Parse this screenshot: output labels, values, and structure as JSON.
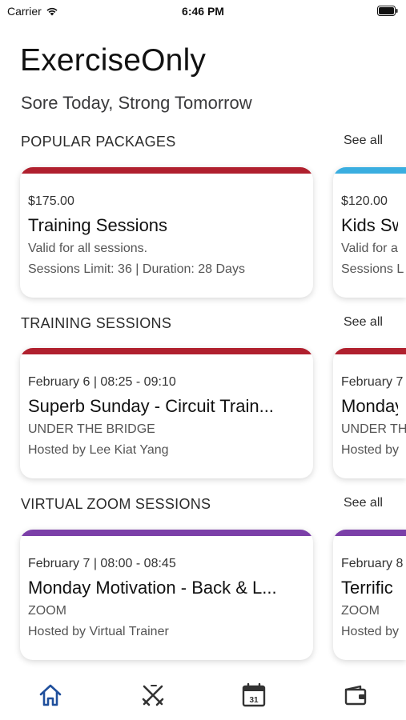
{
  "status_bar": {
    "carrier": "Carrier",
    "time": "6:46 PM",
    "wifi_icon": "wifi-icon",
    "battery_icon": "battery-icon"
  },
  "app": {
    "title": "ExerciseOnly",
    "subtitle": "Sore Today, Strong Tomorrow"
  },
  "sections": [
    {
      "header": "POPULAR PACKAGES",
      "see_all": "See all",
      "cards": [
        {
          "color": "#b0202e",
          "line1": "$175.00",
          "title": "Training Sessions",
          "line3": "Valid for all sessions.",
          "line4": "Sessions Limit: 36 | Duration: 28 Days"
        },
        {
          "color": "#3aaee0",
          "line1": "$120.00",
          "title": "Kids Sw",
          "line3": "Valid for a",
          "line4": "Sessions L"
        }
      ]
    },
    {
      "header": "TRAINING SESSIONS",
      "see_all": "See all",
      "cards": [
        {
          "color": "#b0202e",
          "line1": "February 6 | 08:25 - 09:10",
          "title": "Superb Sunday - Circuit Train...",
          "line3": "UNDER THE BRIDGE",
          "line4": "Hosted by Lee Kiat Yang"
        },
        {
          "color": "#b0202e",
          "line1": "February 7",
          "title": "Monday",
          "line3": "UNDER TH",
          "line4": "Hosted by"
        }
      ]
    },
    {
      "header": "VIRTUAL ZOOM SESSIONS",
      "see_all": "See all",
      "cards": [
        {
          "color": "#7b3fa8",
          "line1": "February 7 | 08:00 - 08:45",
          "title": "Monday Motivation - Back & L...",
          "line3": "ZOOM",
          "line4": "Hosted by Virtual Trainer"
        },
        {
          "color": "#7b3fa8",
          "line1": "February 8",
          "title": "Terrific",
          "line3": "ZOOM",
          "line4": "Hosted by"
        }
      ]
    }
  ],
  "tab_bar": {
    "active_color": "#1f4f9c",
    "inactive_color": "#333333",
    "tabs": [
      "home-icon",
      "cross-swords-icon",
      "calendar-icon",
      "wallet-icon"
    ],
    "calendar_day": "31"
  }
}
